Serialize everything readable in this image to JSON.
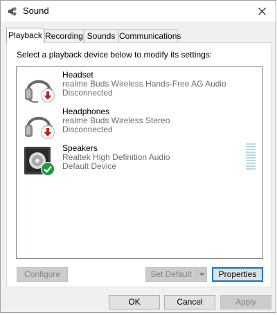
{
  "window": {
    "title": "Sound",
    "title_icon": "speaker-icon",
    "close_icon": "close-icon"
  },
  "tabs": [
    {
      "label": "Playback",
      "active": true
    },
    {
      "label": "Recording",
      "active": false
    },
    {
      "label": "Sounds",
      "active": false
    },
    {
      "label": "Communications",
      "active": false
    }
  ],
  "playback": {
    "instruction": "Select a playback device below to modify its settings:",
    "devices": [
      {
        "name": "Headset",
        "line1": "realme Buds Wireless Hands-Free AG Audio",
        "line2": "Disconnected",
        "icon": "headset-icon",
        "status_icon": "disconnected-arrow-icon",
        "status_color": "#d01818"
      },
      {
        "name": "Headphones",
        "line1": "realme Buds Wireless Stereo",
        "line2": "Disconnected",
        "icon": "headphones-icon",
        "status_icon": "disconnected-arrow-icon",
        "status_color": "#d01818"
      },
      {
        "name": "Speakers",
        "line1": "Realtek High Definition Audio",
        "line2": "Default Device",
        "icon": "speakers-icon",
        "status_icon": "default-check-icon",
        "status_color": "#1c9a3c"
      }
    ],
    "configure_label": "Configure",
    "set_default_label": "Set Default",
    "properties_label": "Properties"
  },
  "footer": {
    "ok_label": "OK",
    "cancel_label": "Cancel",
    "apply_label": "Apply"
  },
  "colors": {
    "accent": "#0078d7",
    "meter": "#b6d7e0"
  }
}
